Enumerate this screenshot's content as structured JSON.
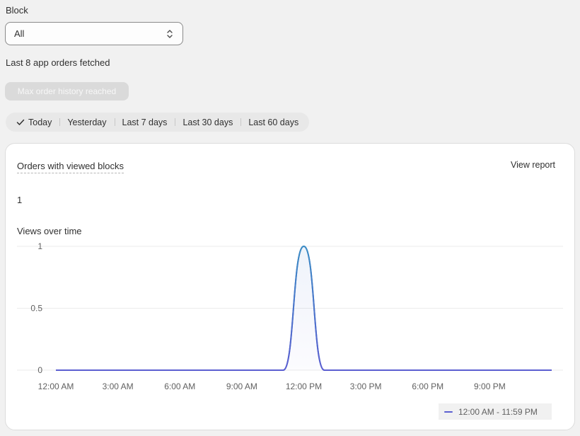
{
  "block": {
    "label": "Block",
    "selected": "All"
  },
  "fetched_text": "Last 8 app orders fetched",
  "max_button_label": "Max order history reached",
  "date_tabs": [
    {
      "label": "Today",
      "selected": true
    },
    {
      "label": "Yesterday",
      "selected": false
    },
    {
      "label": "Last 7 days",
      "selected": false
    },
    {
      "label": "Last 30 days",
      "selected": false
    },
    {
      "label": "Last 60 days",
      "selected": false
    }
  ],
  "card": {
    "title": "Orders with viewed blocks",
    "view_report_label": "View report",
    "metric_value": "1",
    "chart_title": "Views over time"
  },
  "legend": {
    "label": "12:00 AM - 11:59 PM",
    "color": "#5b5fd1"
  },
  "icons": {
    "select": "chevron-updown-icon",
    "selected_tab": "check-icon"
  },
  "colors": {
    "line_start": "#3a8fc4",
    "line_end": "#5b5fd1",
    "grid": "#ebebeb"
  },
  "chart_data": {
    "type": "line",
    "title": "Views over time",
    "xlabel": "",
    "ylabel": "",
    "x_ticks": [
      "12:00 AM",
      "3:00 AM",
      "6:00 AM",
      "9:00 AM",
      "12:00 PM",
      "3:00 PM",
      "6:00 PM",
      "9:00 PM"
    ],
    "y_ticks": [
      "0",
      "0.5",
      "1"
    ],
    "ylim": [
      0,
      1
    ],
    "x": [
      "12:00 AM",
      "1:00 AM",
      "2:00 AM",
      "3:00 AM",
      "4:00 AM",
      "5:00 AM",
      "6:00 AM",
      "7:00 AM",
      "8:00 AM",
      "9:00 AM",
      "10:00 AM",
      "11:00 AM",
      "12:00 PM",
      "1:00 PM",
      "2:00 PM",
      "3:00 PM",
      "4:00 PM",
      "5:00 PM",
      "6:00 PM",
      "7:00 PM",
      "8:00 PM",
      "9:00 PM",
      "10:00 PM",
      "11:00 PM"
    ],
    "series": [
      {
        "name": "12:00 AM - 11:59 PM",
        "values": [
          0,
          0,
          0,
          0,
          0,
          0,
          0,
          0,
          0,
          0,
          0,
          0,
          1,
          0,
          0,
          0,
          0,
          0,
          0,
          0,
          0,
          0,
          0,
          0
        ]
      }
    ],
    "grid": true,
    "legend_position": "bottom-right"
  }
}
